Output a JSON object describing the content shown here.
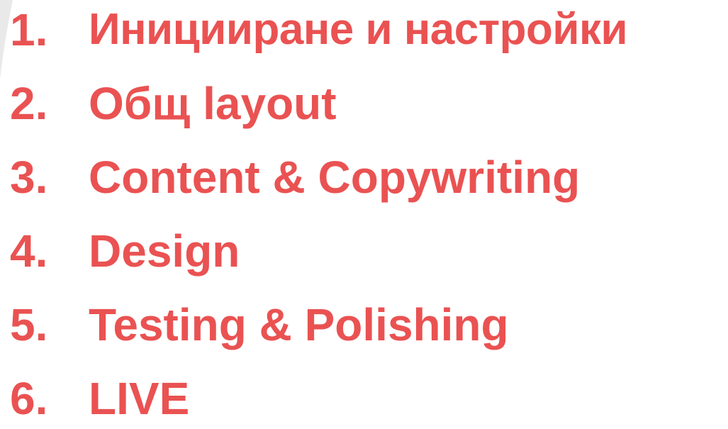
{
  "colors": {
    "text": "#ea5252",
    "background": "#ffffff",
    "corner_shape": "#e9e9e9"
  },
  "list": {
    "items": [
      {
        "number": "1.",
        "label": "Иницииране и настройки"
      },
      {
        "number": "2.",
        "label": "Общ layout"
      },
      {
        "number": "3.",
        "label": "Content & Copywriting"
      },
      {
        "number": "4.",
        "label": "Design"
      },
      {
        "number": "5.",
        "label": "Testing & Polishing"
      },
      {
        "number": "6.",
        "label": "LIVE"
      }
    ]
  }
}
